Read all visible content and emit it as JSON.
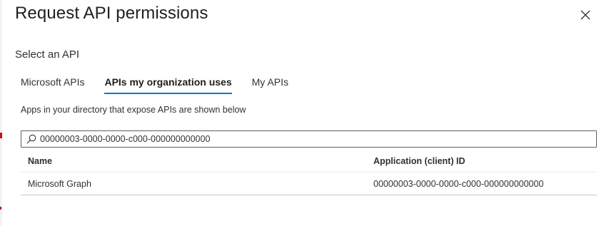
{
  "panel": {
    "title": "Request API permissions",
    "close_icon": "close-icon"
  },
  "select_label": "Select an API",
  "tabs": [
    {
      "label": "Microsoft APIs",
      "active": false
    },
    {
      "label": "APIs my organization uses",
      "active": true
    },
    {
      "label": "My APIs",
      "active": false
    }
  ],
  "description": "Apps in your directory that expose APIs are shown below",
  "search": {
    "icon": "search-icon",
    "value": "00000003-0000-0000-c000-000000000000"
  },
  "table": {
    "columns": [
      "Name",
      "Application (client) ID"
    ],
    "rows": [
      {
        "name": "Microsoft Graph",
        "id": "00000003-0000-0000-c000-000000000000"
      }
    ]
  },
  "colors": {
    "accent": "#0078d4",
    "text": "#323130",
    "border": "#605e5c"
  }
}
